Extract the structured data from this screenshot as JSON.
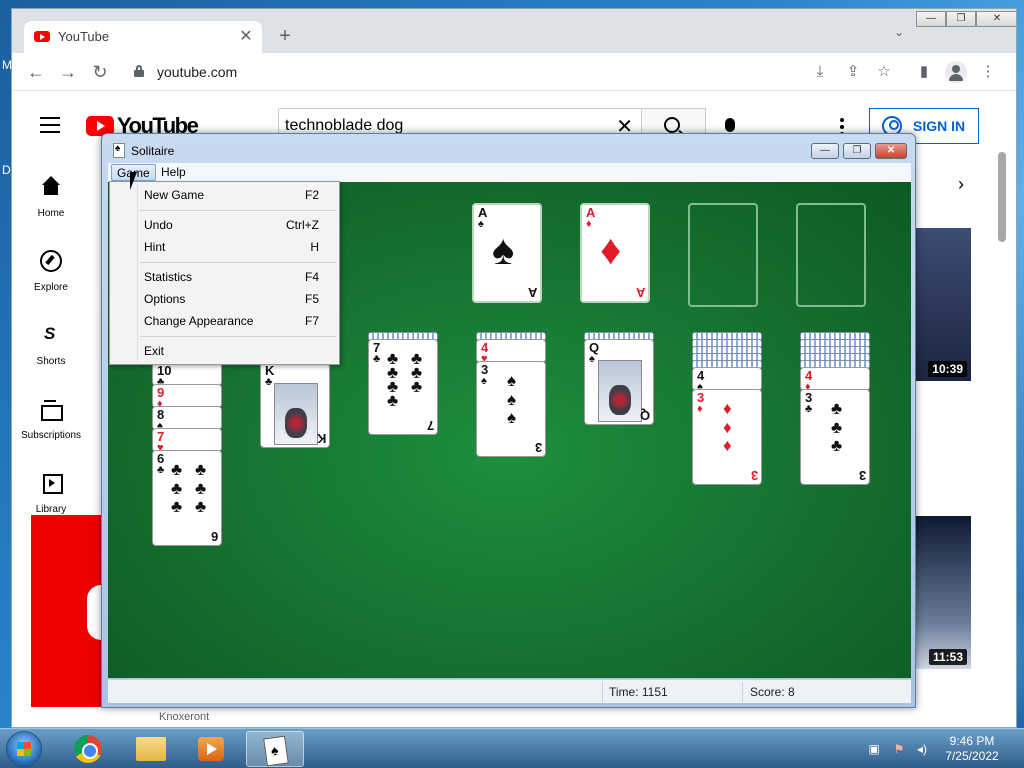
{
  "desktop": {
    "letters": [
      "M",
      "D"
    ]
  },
  "browser": {
    "tab_title": "YouTube",
    "tab_close": "✕",
    "new_tab": "+",
    "tab_search": "⌄",
    "window_controls": [
      "—",
      "❐",
      "✕"
    ],
    "url": "youtube.com",
    "nav": {
      "back": "←",
      "forward": "→",
      "reload": "↻"
    },
    "toolbar_icons": {
      "install": "⤓",
      "share": "⇪",
      "bookmark": "☆",
      "sidebar": "▮",
      "menu": "⋮"
    }
  },
  "youtube": {
    "logo_text": "YouTube",
    "search_value": "technoblade dog",
    "search_clear": "✕",
    "sign_in": "SIGN IN",
    "sidebar": [
      {
        "label": "Home",
        "icon": "home-icon"
      },
      {
        "label": "Explore",
        "icon": "explore-icon"
      },
      {
        "label": "Shorts",
        "icon": "shorts-icon"
      },
      {
        "label": "Subscriptions",
        "icon": "subscriptions-icon"
      },
      {
        "label": "Library",
        "icon": "library-icon"
      }
    ],
    "chip_next": "›",
    "durations": [
      "10:39",
      "11:53"
    ],
    "channel_fragment": "Knoxeront"
  },
  "solitaire": {
    "title": "Solitaire",
    "controls": [
      "—",
      "❐",
      "✕"
    ],
    "menus": [
      "Game",
      "Help"
    ],
    "game_menu": [
      {
        "label": "New Game",
        "shortcut": "F2"
      },
      {
        "label": "Undo",
        "shortcut": "Ctrl+Z"
      },
      {
        "label": "Hint",
        "shortcut": "H"
      },
      {
        "label": "Statistics",
        "shortcut": "F4"
      },
      {
        "label": "Options",
        "shortcut": "F5"
      },
      {
        "label": "Change Appearance",
        "shortcut": "F7"
      },
      {
        "label": "Exit",
        "shortcut": ""
      }
    ],
    "status": {
      "time": "Time: 1151",
      "score": "Score: 8"
    },
    "foundations": [
      {
        "rank": "A",
        "suit": "♠",
        "color": "blk"
      },
      {
        "rank": "A",
        "suit": "♦",
        "color": "red"
      },
      null,
      null
    ],
    "tableau": [
      {
        "cards": [
          {
            "rank": "10",
            "suit": "♣",
            "color": "blk"
          },
          {
            "rank": "9",
            "suit": "♦",
            "color": "red"
          },
          {
            "rank": "8",
            "suit": "♠",
            "color": "blk"
          },
          {
            "rank": "7",
            "suit": "♥",
            "color": "red"
          },
          {
            "rank": "6",
            "suit": "♣",
            "color": "blk"
          }
        ]
      },
      {
        "top": {
          "rank": "K",
          "suit": "♣",
          "color": "blk",
          "face": true
        }
      },
      {
        "backs": 1,
        "top": {
          "rank": "7",
          "suit": "♣",
          "color": "blk"
        }
      },
      {
        "backs": 1,
        "peek": {
          "rank": "4",
          "suit": "♥",
          "color": "red"
        },
        "top": {
          "rank": "3",
          "suit": "♠",
          "color": "blk"
        }
      },
      {
        "backs": 1,
        "top": {
          "rank": "Q",
          "suit": "♠",
          "color": "blk",
          "face": true
        }
      },
      {
        "backs": 5,
        "peek": {
          "rank": "4",
          "suit": "♠",
          "color": "blk"
        },
        "top": {
          "rank": "3",
          "suit": "♦",
          "color": "red"
        }
      },
      {
        "backs": 5,
        "peek": {
          "rank": "4",
          "suit": "♦",
          "color": "red"
        },
        "top": {
          "rank": "3",
          "suit": "♣",
          "color": "blk"
        }
      }
    ]
  },
  "taskbar": {
    "apps": [
      "chrome-icon",
      "explorer-icon",
      "media-player-icon",
      "solitaire-icon"
    ],
    "tray": [
      "network-icon",
      "flag-icon",
      "volume-icon"
    ],
    "time": "9:46 PM",
    "date": "7/25/2022"
  }
}
